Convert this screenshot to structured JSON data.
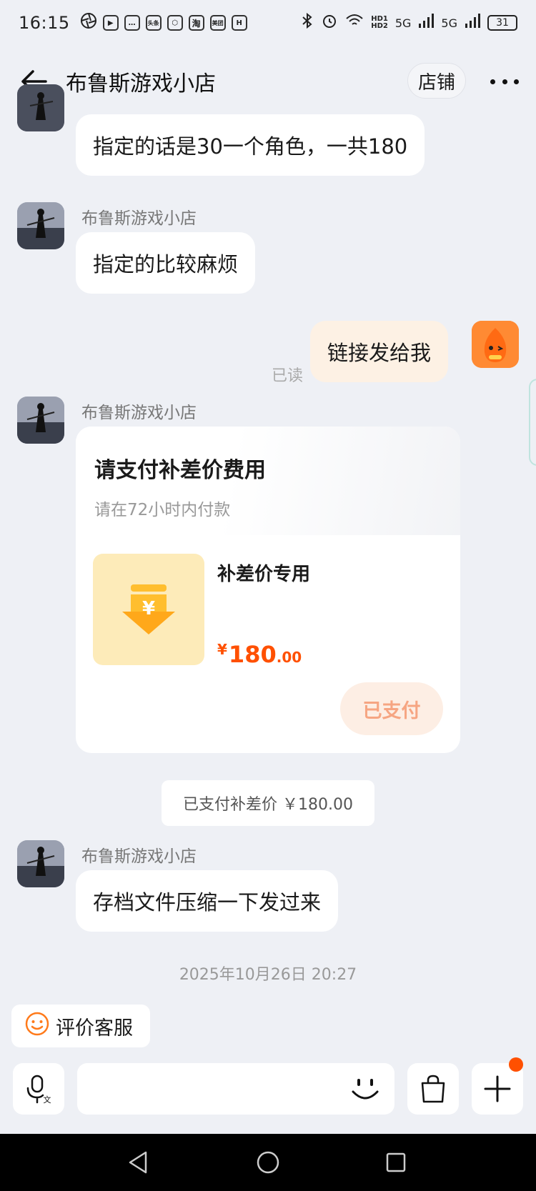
{
  "status_bar": {
    "time": "16:15",
    "app_icons": [
      "头条",
      "淘",
      "美团",
      "H"
    ],
    "network_1": "5G",
    "network_2": "5G",
    "hd_1": "HD1",
    "hd_2": "HD2",
    "battery": "31"
  },
  "header": {
    "title": "布鲁斯游戏小店",
    "store_label": "店铺"
  },
  "messages": {
    "m1": {
      "text": "指定的话是30一个角色，一共180"
    },
    "m2": {
      "sender": "布鲁斯游戏小店",
      "text": "指定的比较麻烦"
    },
    "m3": {
      "text": "链接发给我",
      "read_status": "已读"
    },
    "m4": {
      "sender": "布鲁斯游戏小店",
      "card": {
        "title": "请支付补差价费用",
        "subtitle": "请在72小时内付款",
        "product_name": "补差价专用",
        "currency": "¥",
        "price_int": "180",
        "price_dec": ".00",
        "button_label": "已支付"
      }
    },
    "system_note": "已支付补差价 ￥180.00",
    "m5": {
      "sender": "布鲁斯游戏小店",
      "text": "存档文件压缩一下发过来"
    },
    "timestamp": "2025年10月26日 20:27"
  },
  "quick_actions": {
    "rate_label": "评价客服"
  },
  "input": {
    "placeholder": ""
  },
  "colors": {
    "accent": "#ff5000",
    "my_bubble": "#fdf1e4",
    "background": "#eef0f5"
  }
}
